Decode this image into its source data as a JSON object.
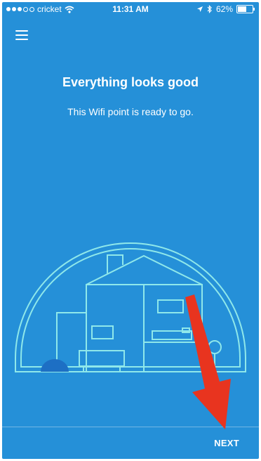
{
  "status_bar": {
    "carrier": "cricket",
    "time": "11:31 AM",
    "battery": "62%",
    "battery_level": 0.62
  },
  "icons": {
    "menu": "hamburger-menu-icon",
    "wifi": "wifi-icon",
    "location": "location-arrow-icon",
    "bluetooth": "bluetooth-icon",
    "battery": "battery-icon"
  },
  "main": {
    "title": "Everything looks good",
    "subtitle": "This Wifi point is ready to go."
  },
  "footer": {
    "next_label": "NEXT"
  },
  "colors": {
    "background": "#2590d8",
    "illustration_line": "#8fe8ea",
    "annotation_arrow": "#e8341f"
  }
}
